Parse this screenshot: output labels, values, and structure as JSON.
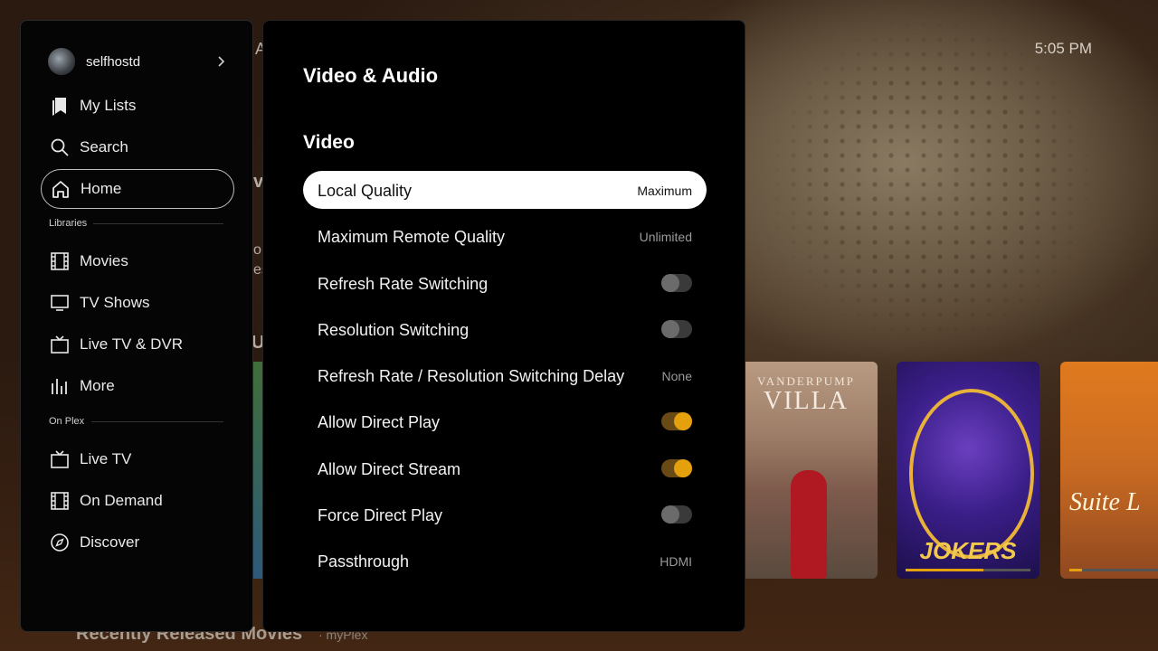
{
  "clock": "5:05 PM",
  "background": {
    "row_title": "Recently Released Movies",
    "row_subtitle": "· myPlex",
    "peek_texts": [
      "A",
      "va",
      "on",
      "es",
      "U"
    ]
  },
  "posters": [
    {
      "name": "vanderpump-villa",
      "line1": "VANDERPUMP",
      "line2": "VILLA"
    },
    {
      "name": "impractical-jokers",
      "line1": "JOKERS",
      "progress": 0.62
    },
    {
      "name": "suite-life",
      "line1": "Suite L",
      "progress": 0.14
    }
  ],
  "sidebar": {
    "user": {
      "name": "selfhostd"
    },
    "top_items": [
      {
        "label": "My Lists",
        "icon": "bookmark-icon"
      },
      {
        "label": "Search",
        "icon": "search-icon"
      },
      {
        "label": "Home",
        "icon": "home-icon",
        "active": true
      }
    ],
    "libraries_heading": "Libraries",
    "library_items": [
      {
        "label": "Movies",
        "icon": "film-icon"
      },
      {
        "label": "TV Shows",
        "icon": "monitor-icon"
      },
      {
        "label": "Live TV & DVR",
        "icon": "tv-icon"
      },
      {
        "label": "More",
        "icon": "bars-icon"
      }
    ],
    "onplex_heading": "On Plex",
    "onplex_items": [
      {
        "label": "Live TV",
        "icon": "tv-icon"
      },
      {
        "label": "On Demand",
        "icon": "film-icon"
      },
      {
        "label": "Discover",
        "icon": "compass-icon"
      }
    ]
  },
  "settings": {
    "title": "Video & Audio",
    "section": "Video",
    "rows": [
      {
        "label": "Local Quality",
        "value": "Maximum",
        "focused": true
      },
      {
        "label": "Maximum Remote Quality",
        "value": "Unlimited"
      },
      {
        "label": "Refresh Rate Switching",
        "toggle": false
      },
      {
        "label": "Resolution Switching",
        "toggle": false
      },
      {
        "label": "Refresh Rate / Resolution Switching Delay",
        "value": "None"
      },
      {
        "label": "Allow Direct Play",
        "toggle": true
      },
      {
        "label": "Allow Direct Stream",
        "toggle": true
      },
      {
        "label": "Force Direct Play",
        "toggle": false
      },
      {
        "label": "Passthrough",
        "value": "HDMI"
      }
    ]
  },
  "colors": {
    "accent": "#e5a00d",
    "panel": "#000000",
    "focus": "#ffffff"
  }
}
